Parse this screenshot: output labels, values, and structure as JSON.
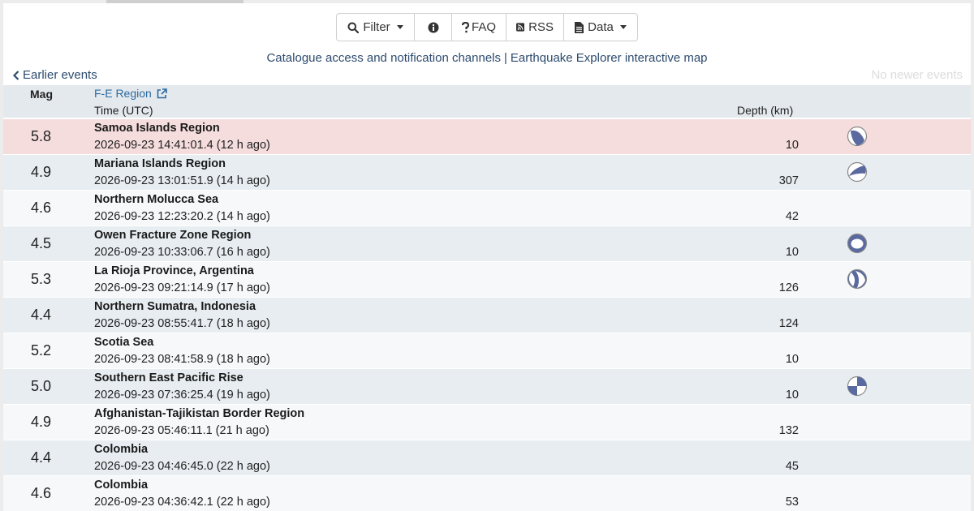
{
  "toolbar": {
    "filter_label": "Filter",
    "faq_label": "FAQ",
    "rss_label": "RSS",
    "data_label": "Data"
  },
  "links": {
    "catalogue": "Catalogue access and notification channels",
    "separator": "|",
    "explorer": "Earthquake Explorer interactive map"
  },
  "nav": {
    "earlier": "Earlier events",
    "newer": "No newer events"
  },
  "table": {
    "headers": {
      "mag": "Mag",
      "region": "F-E Region",
      "time": "Time (UTC)",
      "depth": "Depth (km)"
    },
    "rows": [
      {
        "mag": "5.8",
        "region": "Samoa Islands Region",
        "time": "2026-09-23 14:41:01.4 (12 h ago)",
        "depth": "10",
        "mechanism": "a"
      },
      {
        "mag": "4.9",
        "region": "Mariana Islands Region",
        "time": "2026-09-23 13:01:51.9 (14 h ago)",
        "depth": "307",
        "mechanism": "b"
      },
      {
        "mag": "4.6",
        "region": "Northern Molucca Sea",
        "time": "2026-09-23 12:23:20.2 (14 h ago)",
        "depth": "42",
        "mechanism": ""
      },
      {
        "mag": "4.5",
        "region": "Owen Fracture Zone Region",
        "time": "2026-09-23 10:33:06.7 (16 h ago)",
        "depth": "10",
        "mechanism": "c"
      },
      {
        "mag": "5.3",
        "region": "La Rioja Province, Argentina",
        "time": "2026-09-23 09:21:14.9 (17 h ago)",
        "depth": "126",
        "mechanism": "d"
      },
      {
        "mag": "4.4",
        "region": "Northern Sumatra, Indonesia",
        "time": "2026-09-23 08:55:41.7 (18 h ago)",
        "depth": "124",
        "mechanism": ""
      },
      {
        "mag": "5.2",
        "region": "Scotia Sea",
        "time": "2026-09-23 08:41:58.9 (18 h ago)",
        "depth": "10",
        "mechanism": ""
      },
      {
        "mag": "5.0",
        "region": "Southern East Pacific Rise",
        "time": "2026-09-23 07:36:25.4 (19 h ago)",
        "depth": "10",
        "mechanism": "e"
      },
      {
        "mag": "4.9",
        "region": "Afghanistan-Tajikistan Border Region",
        "time": "2026-09-23 05:46:11.1 (21 h ago)",
        "depth": "132",
        "mechanism": ""
      },
      {
        "mag": "4.4",
        "region": "Colombia",
        "time": "2026-09-23 04:46:45.0 (22 h ago)",
        "depth": "45",
        "mechanism": ""
      },
      {
        "mag": "4.6",
        "region": "Colombia",
        "time": "2026-09-23 04:36:42.1 (22 h ago)",
        "depth": "53",
        "mechanism": ""
      }
    ]
  },
  "colors": {
    "link": "#2c4a6e",
    "alert_row": "#f5dcdd",
    "beachball": "#5a6aa0"
  }
}
